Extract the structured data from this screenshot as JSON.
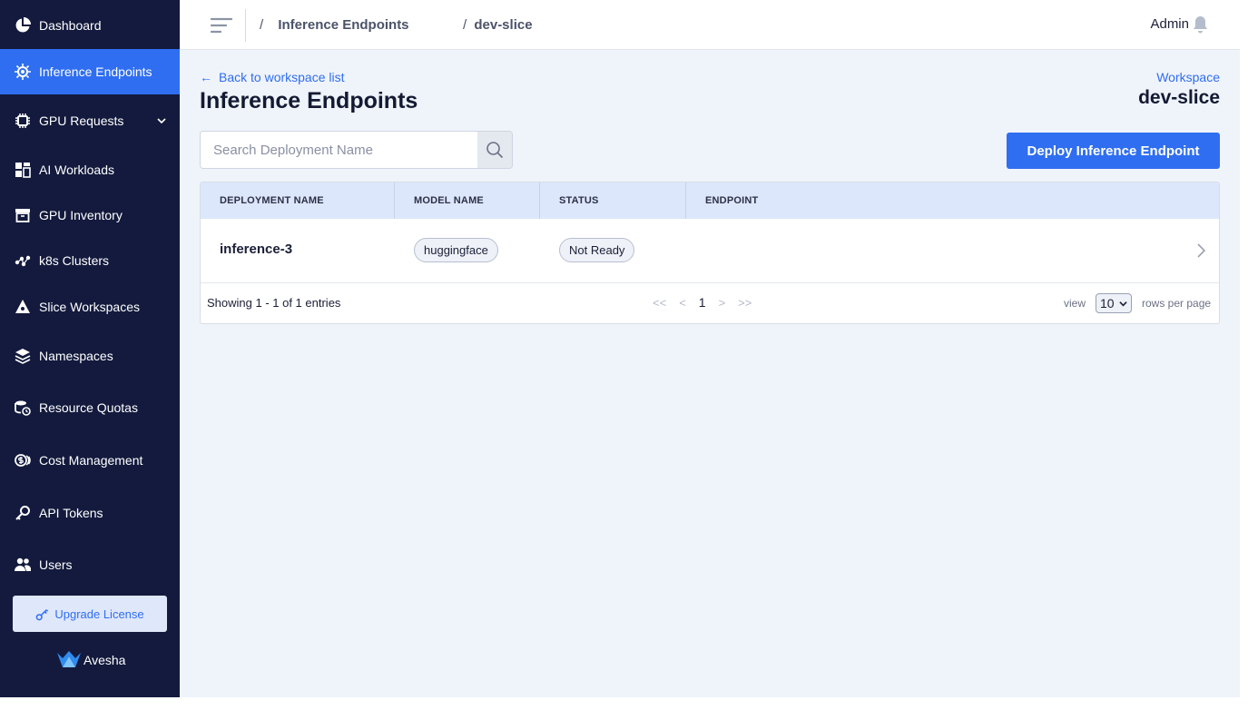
{
  "sidebar": {
    "items": [
      {
        "label": "Dashboard",
        "icon": "pie-chart-icon"
      },
      {
        "label": "Inference Endpoints",
        "icon": "cpu-gear-icon",
        "active": true
      },
      {
        "label": "GPU Requests",
        "icon": "chip-icon",
        "has_submenu": true
      },
      {
        "label": "AI Workloads",
        "icon": "grid-icon"
      },
      {
        "label": "GPU Inventory",
        "icon": "archive-box-icon"
      },
      {
        "label": "k8s Clusters",
        "icon": "network-nodes-icon"
      },
      {
        "label": "Slice Workspaces",
        "icon": "slice-icon"
      },
      {
        "label": "Namespaces",
        "icon": "layers-icon"
      },
      {
        "label": "Resource Quotas",
        "icon": "database-clock-icon"
      },
      {
        "label": "Cost Management",
        "icon": "dollar-coins-icon"
      },
      {
        "label": "API Tokens",
        "icon": "key-icon"
      },
      {
        "label": "Users",
        "icon": "users-icon"
      }
    ],
    "upgrade_label": "Upgrade License",
    "brand": "Avesha"
  },
  "header": {
    "breadcrumbs": [
      "Inference Endpoints",
      "dev-slice"
    ],
    "separator": "/",
    "user": "Admin"
  },
  "main": {
    "back_label": "Back to workspace list",
    "title": "Inference Endpoints",
    "workspace_label": "Workspace",
    "workspace_name": "dev-slice",
    "search": {
      "placeholder": "Search Deployment Name",
      "value": ""
    },
    "deploy_label": "Deploy Inference Endpoint",
    "table": {
      "columns": [
        "DEPLOYMENT NAME",
        "MODEL NAME",
        "STATUS",
        "ENDPOINT"
      ],
      "rows": [
        {
          "deployment_name": "inference-3",
          "model_name": "huggingface",
          "status": "Not Ready",
          "endpoint": ""
        }
      ]
    },
    "footer": {
      "showing": "Showing 1 - 1 of 1 entries",
      "first": "<<",
      "prev": "<",
      "current_page": "1",
      "next": ">",
      "last": ">>",
      "view_label": "view",
      "rows_per_page": "10",
      "rows_label": "rows per page"
    }
  },
  "colors": {
    "sidebar_bg": "#131a3d",
    "accent": "#2f6ef0",
    "main_bg": "#eff3fa",
    "table_header_bg": "#dde7fb"
  }
}
